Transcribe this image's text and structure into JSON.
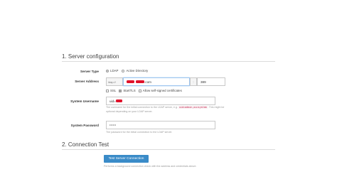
{
  "sections": {
    "server_config_title": "1. Server configuration",
    "connection_test_title": "2. Connection Test"
  },
  "server_type": {
    "label": "Server Type",
    "options": [
      {
        "label": "LDAP",
        "selected": true
      },
      {
        "label": "Active Directory",
        "selected": false
      }
    ]
  },
  "server_address": {
    "label": "Server Address",
    "protocol_prefix": "ldap://",
    "host_suffix": ".com",
    "port_separator": ":",
    "port": "389",
    "options": [
      {
        "label": "SSL",
        "checked": false
      },
      {
        "label": "StartTLS",
        "checked": true
      },
      {
        "label": "Allow self-signed certificates",
        "checked": false
      }
    ]
  },
  "system_username": {
    "label": "System Username",
    "value_prefix": "uid=",
    "help_before": "The username for the initial connection to the LDAP server, e.g.",
    "help_example": "uid=admin,ou=system",
    "help_after": ". This might be optional depending on your LDAP server."
  },
  "system_password": {
    "label": "System Password",
    "value": "••••••",
    "help": "The password for the initial connection to the LDAP server."
  },
  "connection_test": {
    "button_label": "Test Server Connection",
    "help": "Performs a background connection check with the address and credentials above."
  },
  "colors": {
    "accent": "#3a8bc8",
    "redaction": "#e0112a"
  }
}
